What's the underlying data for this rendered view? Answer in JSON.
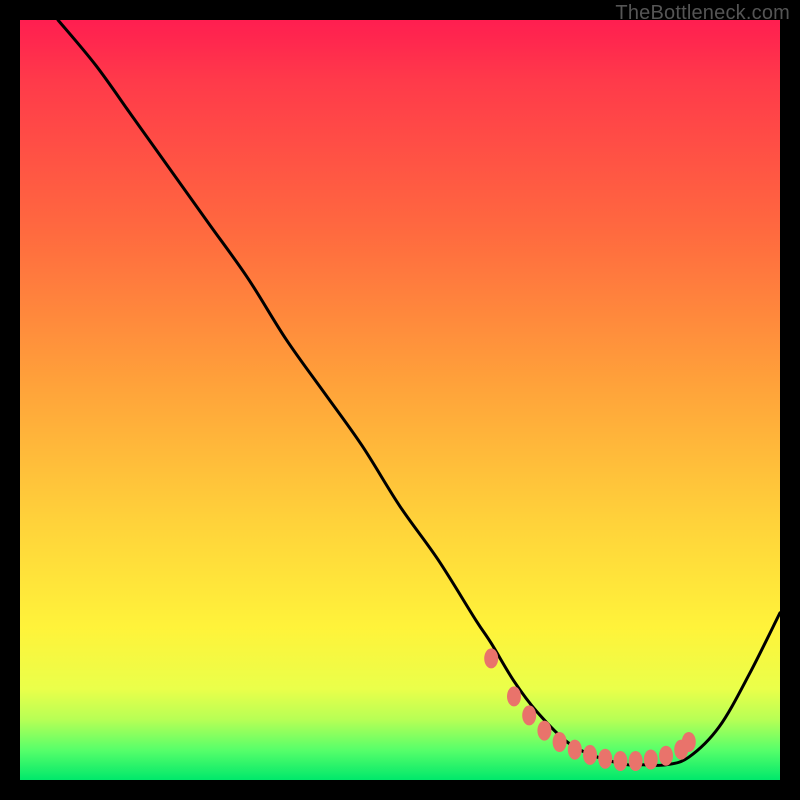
{
  "watermark": "TheBottleneck.com",
  "chart_data": {
    "type": "line",
    "title": "",
    "xlabel": "",
    "ylabel": "",
    "xlim": [
      0,
      100
    ],
    "ylim": [
      0,
      100
    ],
    "series": [
      {
        "name": "bottleneck-curve",
        "x": [
          5,
          10,
          15,
          20,
          25,
          30,
          35,
          40,
          45,
          50,
          55,
          60,
          62,
          65,
          68,
          72,
          76,
          80,
          82,
          85,
          88,
          92,
          96,
          100
        ],
        "y": [
          100,
          94,
          87,
          80,
          73,
          66,
          58,
          51,
          44,
          36,
          29,
          21,
          18,
          13,
          9,
          5,
          3,
          2,
          2,
          2,
          3,
          7,
          14,
          22
        ]
      }
    ],
    "markers": {
      "name": "optimal-range-dots",
      "x": [
        62,
        65,
        67,
        69,
        71,
        73,
        75,
        77,
        79,
        81,
        83,
        85,
        87,
        88
      ],
      "y": [
        16,
        11,
        8.5,
        6.5,
        5,
        4,
        3.3,
        2.8,
        2.5,
        2.5,
        2.7,
        3.2,
        4,
        5
      ]
    },
    "gradient_scale": {
      "meaning": "bottleneck_percent",
      "top_color": "#ff1e50",
      "bottom_color": "#00e86b"
    }
  }
}
